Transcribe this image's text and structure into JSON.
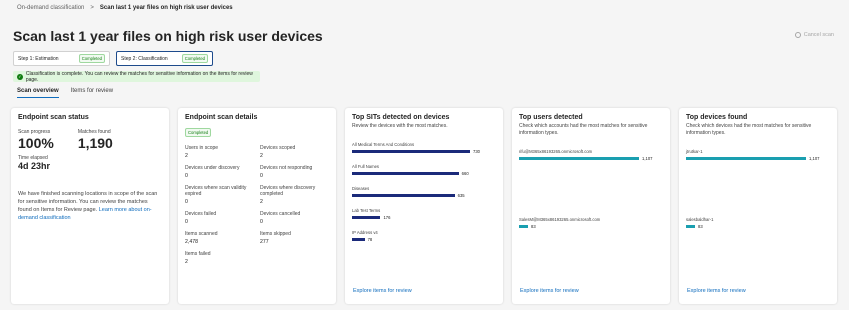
{
  "breadcrumb": {
    "parent": "On-demand classification",
    "separator": ">",
    "current": "Scan last 1 year files on high risk user devices"
  },
  "page_title": "Scan last 1 year files on high risk user devices",
  "cancel_scan": "Cancel scan",
  "steps": [
    {
      "label": "Step 1: Estimation",
      "status": "Completed"
    },
    {
      "label": "Step 2: Classification",
      "status": "Completed"
    }
  ],
  "message": "Classification is complete. You can review the matches for sensitive information on the items for review page.",
  "tabs": [
    "Scan overview",
    "Items for review"
  ],
  "status_card": {
    "title": "Endpoint scan status",
    "progress_label": "Scan progress",
    "progress_value": "100%",
    "matches_label": "Matches found",
    "matches_value": "1,190",
    "elapsed_label": "Time elapsed",
    "elapsed_value": "4d 23hr",
    "desc": "We have finished scanning locations in scope of the scan for sensitive information. You can review the matches found on Items for Review page.",
    "learn_more": "Learn more about on-demand classification"
  },
  "details_card": {
    "title": "Endpoint scan details",
    "status": "Completed",
    "items": [
      {
        "label": "Users in scope",
        "value": "2"
      },
      {
        "label": "Devices scoped",
        "value": "2"
      },
      {
        "label": "Devices under discovery",
        "value": "0"
      },
      {
        "label": "Devices not responding",
        "value": "0"
      },
      {
        "label": "Devices where scan validity expired",
        "value": "0"
      },
      {
        "label": "Devices where discovery completed",
        "value": "2"
      },
      {
        "label": "Devices failed",
        "value": "0"
      },
      {
        "label": "Devices cancelled",
        "value": "0"
      },
      {
        "label": "Items scanned",
        "value": "2,478"
      },
      {
        "label": "Items skipped",
        "value": "277"
      },
      {
        "label": "Items failed",
        "value": "2"
      }
    ]
  },
  "sit_card": {
    "title": "Top SITs detected on devices",
    "subtitle": "Review the devices with the most matches.",
    "explore": "Explore items for review",
    "bar_color": "#1b2a7a"
  },
  "users_card": {
    "title": "Top users detected",
    "subtitle": "Check which accounts had the most matches for sensitive information types.",
    "explore": "Explore items for review",
    "bar_color": "#1a9fb0"
  },
  "devices_card": {
    "title": "Top devices found",
    "subtitle": "Check which devices had the most matches for sensitive information types.",
    "explore": "Explore items for review",
    "bar_color": "#1a9fb0"
  },
  "chart_data": [
    {
      "type": "bar",
      "title": "Top SITs detected on devices",
      "categories": [
        "All Medical Terms And Conditions",
        "All Full Names",
        "Diseases",
        "Lab Test Terms",
        "IP Address v4"
      ],
      "values": [
        730,
        660,
        635,
        176,
        78
      ],
      "max": 730
    },
    {
      "type": "bar",
      "title": "Top users detected",
      "categories": [
        "rifu@M365x86193265.onmicrosoft.com",
        "SalesM@M365x86193265.onmicrosoft.com"
      ],
      "values": [
        1107,
        83
      ],
      "max": 1107
    },
    {
      "type": "bar",
      "title": "Top devices found",
      "categories": [
        "jtrutkar-1",
        "salesbaldhar-1"
      ],
      "values": [
        1107,
        83
      ],
      "max": 1107
    }
  ]
}
